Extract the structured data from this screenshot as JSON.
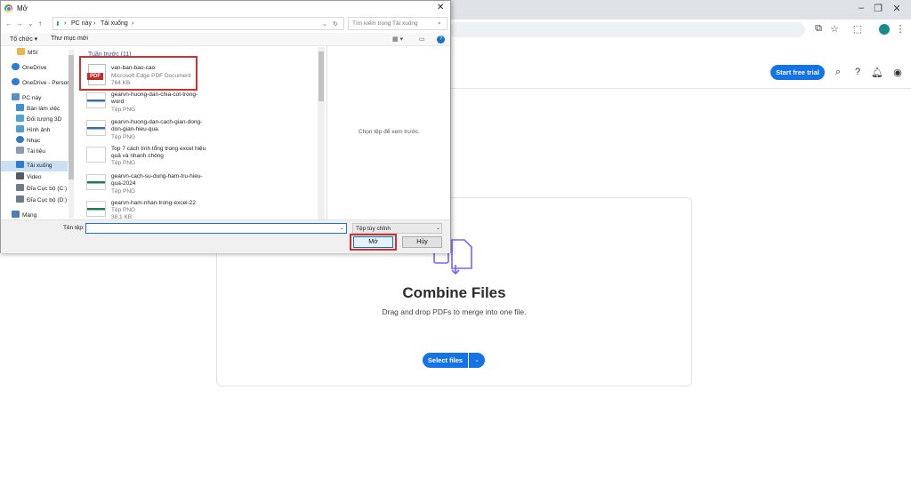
{
  "browser": {
    "window_controls": [
      "–",
      "❐",
      "✕"
    ],
    "profile_initial": ""
  },
  "site": {
    "start_trial": "Start free trial"
  },
  "combine": {
    "title": "Combine Files",
    "subtitle": "Drag and drop PDFs to merge into one file.",
    "select_label": "Select files",
    "select_dropdown": "⌄"
  },
  "dialog": {
    "title": "Mở",
    "close": "✕",
    "path": [
      "PC này",
      "Tải xuống"
    ],
    "search_placeholder": "Tìm kiếm trong Tải xuống",
    "organize": "Tổ chức ▾",
    "new_folder": "Thư mục mới",
    "help": "?",
    "nav_items": [
      {
        "label": "MSI",
        "color": "#e8b84a"
      },
      {
        "label": "OneDrive",
        "color": "#2f7dd1"
      },
      {
        "label": "OneDrive - Person",
        "color": "#2f7dd1"
      },
      {
        "label": "PC này",
        "color": "#5b8fc9"
      },
      {
        "label": "Bàn làm việc",
        "color": "#3d8fd6"
      },
      {
        "label": "Đối tượng 3D",
        "color": "#48a6d9"
      },
      {
        "label": "Hình ảnh",
        "color": "#4f9ed8"
      },
      {
        "label": "Nhạc",
        "color": "#3479c4"
      },
      {
        "label": "Tài liệu",
        "color": "#8a9bb0"
      },
      {
        "label": "Tải xuống",
        "color": "#2f7dd1"
      },
      {
        "label": "Video",
        "color": "#555b66"
      },
      {
        "label": "Đĩa Cục bộ (C:)",
        "color": "#6f7c8c"
      },
      {
        "label": "Đĩa Cục bộ (D:)",
        "color": "#6f7c8c"
      },
      {
        "label": "Mạng",
        "color": "#4a7fb8"
      }
    ],
    "group_header": "Tuần trước (11)",
    "files": [
      {
        "name": "van-ban-bao-cao",
        "type": "Microsoft Edge PDF Document",
        "size": "764 KB"
      },
      {
        "name": "gearvn-huong-dan-chia-cot-trong-word",
        "type": "Tệp PNG",
        "size": ""
      },
      {
        "name": "gearvn-huong-dan-cach-gian-dong-don-gian-hieu-qua",
        "type": "Tệp PNG",
        "size": ""
      },
      {
        "name": "Top 7 cách tính tổng trong excel hiệu quả và nhanh chóng",
        "type": "Tệp PNG",
        "size": ""
      },
      {
        "name": "gearvn-cach-su-dung-ham-tru-hieu-qua-2024",
        "type": "Tệp PNG",
        "size": ""
      },
      {
        "name": "gearvn-ham-nhan-trong-excel-22",
        "type": "Tệp PNG",
        "size": "38,1 KB"
      }
    ],
    "preview_text": "Chọn tệp để xem trước.",
    "filename_label": "Tên tệp:",
    "filename_value": "",
    "filetype": "Tệp tùy chỉnh",
    "open_label": "Mở",
    "cancel_label": "Hủy"
  },
  "colors": {
    "accent": "#1473e6",
    "highlight": "#d32f2f",
    "pdf": "#c62828"
  }
}
